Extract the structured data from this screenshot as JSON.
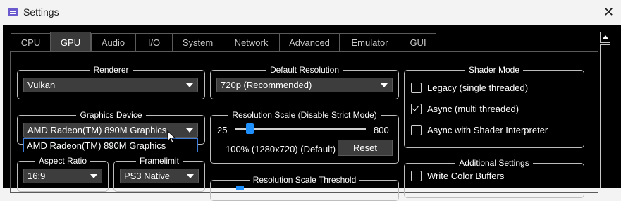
{
  "window": {
    "title": "Settings",
    "close": "✕"
  },
  "tabs": [
    {
      "label": "CPU"
    },
    {
      "label": "GPU"
    },
    {
      "label": "Audio"
    },
    {
      "label": "I/O"
    },
    {
      "label": "System"
    },
    {
      "label": "Network"
    },
    {
      "label": "Advanced"
    },
    {
      "label": "Emulator"
    },
    {
      "label": "GUI"
    }
  ],
  "active_tab": "GPU",
  "renderer": {
    "title": "Renderer",
    "value": "Vulkan"
  },
  "default_resolution": {
    "title": "Default Resolution",
    "value": "720p (Recommended)"
  },
  "shader_mode": {
    "title": "Shader Mode",
    "options": [
      {
        "label": "Legacy (single threaded)",
        "checked": false
      },
      {
        "label": "Async (multi threaded)",
        "checked": true
      },
      {
        "label": "Async with Shader Interpreter",
        "checked": false
      }
    ]
  },
  "graphics_device": {
    "title": "Graphics Device",
    "value": "AMD Radeon(TM) 890M Graphics",
    "dropdown_item": "AMD Radeon(TM) 890M Graphics"
  },
  "resolution_scale": {
    "title": "Resolution Scale (Disable Strict Mode)",
    "min_label": "25",
    "max_label": "800",
    "current_label": "100% (1280x720) (Default)",
    "reset_label": "Reset",
    "value": 100
  },
  "aspect_ratio": {
    "title": "Aspect Ratio",
    "value": "16:9"
  },
  "framelimit": {
    "title": "Framelimit",
    "value": "PS3 Native"
  },
  "resolution_scale_threshold": {
    "title": "Resolution Scale Threshold"
  },
  "additional_settings": {
    "title": "Additional Settings",
    "options": [
      {
        "label": "Write Color Buffers",
        "checked": false
      }
    ]
  },
  "colors": {
    "accent": "#1e90ff",
    "background": "#000000",
    "control": "#3d3d3d"
  }
}
